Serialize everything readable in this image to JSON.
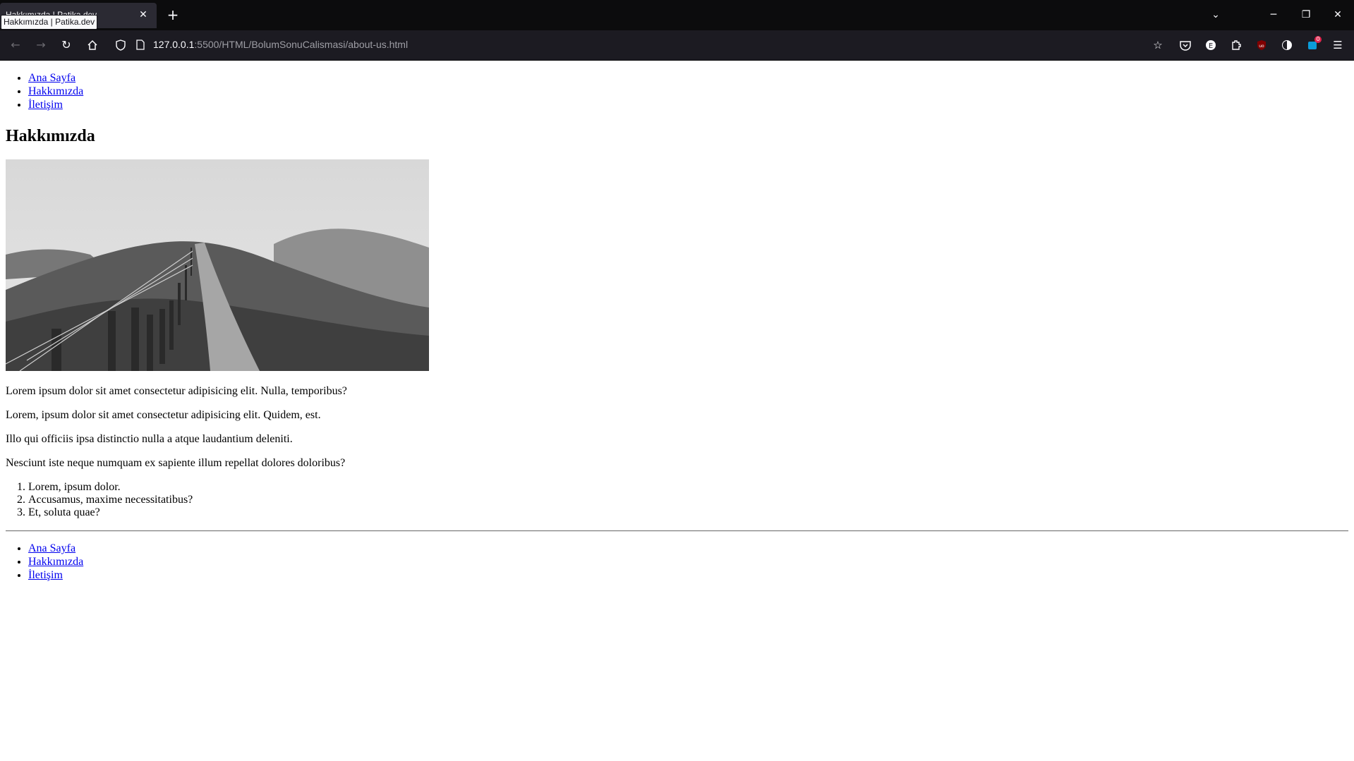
{
  "browser": {
    "tab_title": "Hakkımızda | Patika.dev",
    "tooltip": "Hakkımızda | Patika.dev",
    "new_tab_symbol": "+",
    "tab_close_symbol": "✕",
    "url_host": "127.0.0.1",
    "url_rest": ":5500/HTML/BolumSonuCalismasi/about-us.html",
    "extension_badge": "0",
    "icons": [
      "back-icon",
      "forward-icon",
      "reload-icon",
      "home-icon",
      "shield-icon",
      "page-icon",
      "star-icon",
      "pocket-icon",
      "extension-icon",
      "puzzle-icon",
      "ublock-icon",
      "privacy-icon",
      "container-icon",
      "menu-icon"
    ],
    "window_controls": {
      "list_tabs": "⌄",
      "minimize": "─",
      "restore": "❐",
      "close": "✕"
    }
  },
  "page": {
    "top_nav": [
      "Ana Sayfa",
      "Hakkımızda",
      "İletişim"
    ],
    "heading": "Hakkımızda",
    "image": {
      "subject": "grayscale hillside path with wooden fence"
    },
    "paragraphs": [
      "Lorem ipsum dolor sit amet consectetur adipisicing elit. Nulla, temporibus?",
      "Lorem, ipsum dolor sit amet consectetur adipisicing elit. Quidem, est.",
      "Illo qui officiis ipsa distinctio nulla a atque laudantium deleniti.",
      "Nesciunt iste neque numquam ex sapiente illum repellat dolores doloribus?"
    ],
    "ordered_list": [
      "Lorem, ipsum dolor.",
      "Accusamus, maxime necessitatibus?",
      "Et, soluta quae?"
    ],
    "bottom_nav": [
      "Ana Sayfa",
      "Hakkımızda",
      "İletişim"
    ]
  },
  "colors": {
    "link": "#0000ee",
    "chrome_bg": "#1c1b22",
    "tab_bg": "#2b2a33"
  }
}
